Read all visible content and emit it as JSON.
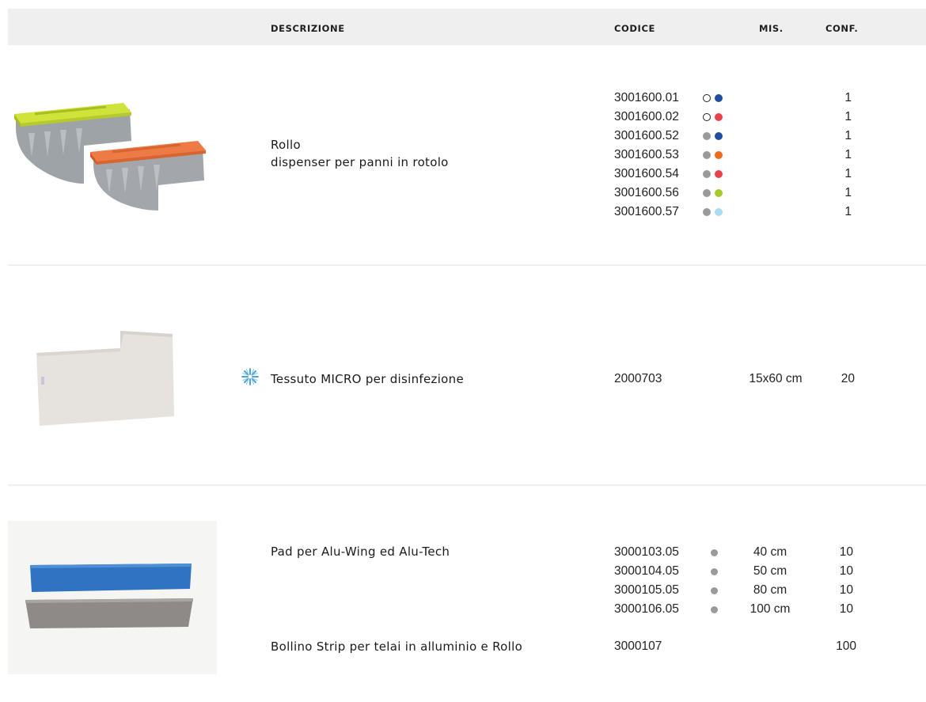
{
  "header": {
    "descrizione": "DESCRIZIONE",
    "codice": "CODICE",
    "mis": "MIS.",
    "conf": "CONF."
  },
  "colors": {
    "white_ring": "#222222",
    "grey": "#9a9a9a",
    "blue": "#1f4ea1",
    "red": "#e8414b",
    "orange": "#ee6b1b",
    "lime": "#a9c92a",
    "light_blue": "#a8dcef"
  },
  "products": [
    {
      "name": "Rollo",
      "subtitle": "dispenser per panni in rotolo",
      "rows": [
        {
          "code": "3001600.01",
          "dots": [
            "white",
            "blue"
          ],
          "conf": "1"
        },
        {
          "code": "3001600.02",
          "dots": [
            "white",
            "red"
          ],
          "conf": "1"
        },
        {
          "code": "3001600.52",
          "dots": [
            "grey",
            "blue"
          ],
          "conf": "1"
        },
        {
          "code": "3001600.53",
          "dots": [
            "grey",
            "orange"
          ],
          "conf": "1"
        },
        {
          "code": "3001600.54",
          "dots": [
            "grey",
            "red"
          ],
          "conf": "1"
        },
        {
          "code": "3001600.56",
          "dots": [
            "grey",
            "lime"
          ],
          "conf": "1"
        },
        {
          "code": "3001600.57",
          "dots": [
            "grey",
            "light_blue"
          ],
          "conf": "1"
        }
      ]
    },
    {
      "name": "Tessuto MICRO per disinfezione",
      "icon": "snowflake-icon",
      "code": "2000703",
      "mis": "15x60 cm",
      "conf": "20"
    },
    {
      "name": "Pad per Alu-Wing ed Alu-Tech",
      "rows": [
        {
          "code": "3000103.05",
          "dot": "grey",
          "mis": "40 cm",
          "conf": "10"
        },
        {
          "code": "3000104.05",
          "dot": "grey",
          "mis": "50 cm",
          "conf": "10"
        },
        {
          "code": "3000105.05",
          "dot": "grey",
          "mis": "80 cm",
          "conf": "10"
        },
        {
          "code": "3000106.05",
          "dot": "grey",
          "mis": "100 cm",
          "conf": "10"
        }
      ],
      "extra": {
        "name": "Bollino Strip per telai in alluminio e Rollo",
        "code": "3000107",
        "conf": "100"
      }
    }
  ]
}
